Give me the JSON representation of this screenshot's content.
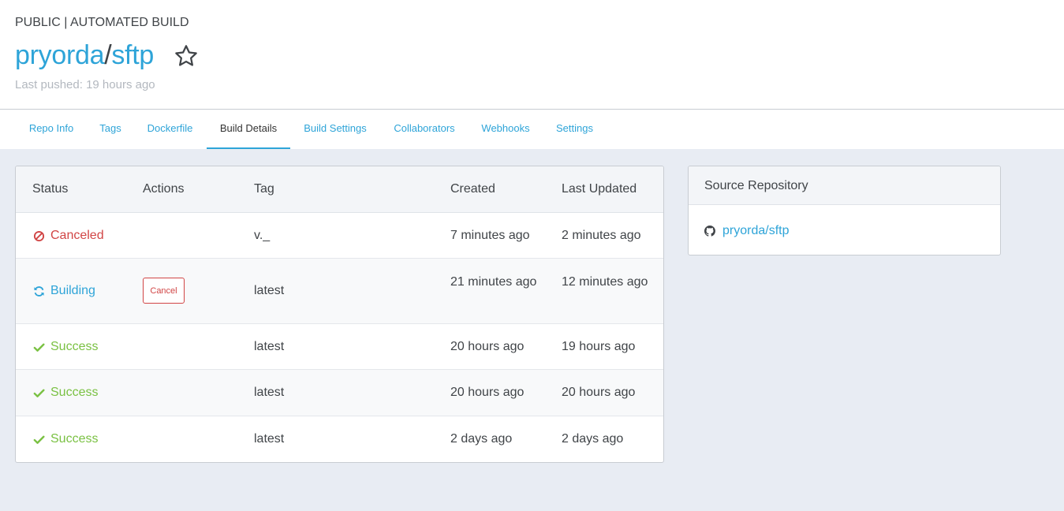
{
  "header": {
    "visibility": "PUBLIC | AUTOMATED BUILD",
    "owner": "pryorda",
    "separator": "/",
    "repo": "sftp",
    "last_pushed": "Last pushed: 19 hours ago"
  },
  "tabs": [
    {
      "label": "Repo Info"
    },
    {
      "label": "Tags"
    },
    {
      "label": "Dockerfile"
    },
    {
      "label": "Build Details",
      "active": true
    },
    {
      "label": "Build Settings"
    },
    {
      "label": "Collaborators"
    },
    {
      "label": "Webhooks"
    },
    {
      "label": "Settings"
    }
  ],
  "builds": {
    "columns": [
      "Status",
      "Actions",
      "Tag",
      "Created",
      "Last Updated"
    ],
    "rows": [
      {
        "status": "Canceled",
        "status_icon": "ban-icon",
        "action": "",
        "tag": "v._",
        "created": "7 minutes ago",
        "updated": "2 minutes ago"
      },
      {
        "status": "Building",
        "status_icon": "refresh-icon",
        "action": "Cancel",
        "tag": "latest",
        "created": "21 minutes ago",
        "updated": "12 minutes ago"
      },
      {
        "status": "Success",
        "status_icon": "check-icon",
        "action": "",
        "tag": "latest",
        "created": "20 hours ago",
        "updated": "19 hours ago"
      },
      {
        "status": "Success",
        "status_icon": "check-icon",
        "action": "",
        "tag": "latest",
        "created": "20 hours ago",
        "updated": "20 hours ago"
      },
      {
        "status": "Success",
        "status_icon": "check-icon",
        "action": "",
        "tag": "latest",
        "created": "2 days ago",
        "updated": "2 days ago"
      }
    ]
  },
  "source": {
    "title": "Source Repository",
    "link": "pryorda/sftp",
    "icon": "github-icon"
  },
  "colors": {
    "accent": "#2ea4d8",
    "canceled": "#d14545",
    "success": "#7ac143",
    "background": "#e8ecf3"
  }
}
